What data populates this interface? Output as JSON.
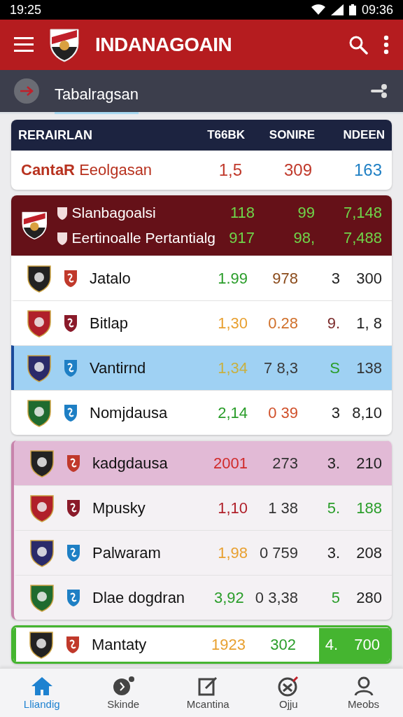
{
  "status_bar": {
    "time": "19:25",
    "clock": "09:36"
  },
  "app_bar": {
    "title": "INDANAGOAIN"
  },
  "sub_bar": {
    "title": "Tabalragsan"
  },
  "table": {
    "columns": [
      "RERAIRLAN",
      "T66BK",
      "SONIRE",
      "NDEEN"
    ],
    "summary": {
      "label_bold": "CantaR",
      "label": "Eeolgasan",
      "values": [
        {
          "text": "1,5",
          "color": "#c0392b"
        },
        {
          "text": "309",
          "color": "#c0392b"
        },
        {
          "text": "163",
          "color": "#1e7fc4"
        }
      ]
    }
  },
  "groups": [
    {
      "kind": "maroon",
      "featured": [
        {
          "name": "Slanbagoalsi",
          "values": [
            "118",
            "99",
            "7,148"
          ]
        },
        {
          "name": "Eertinoalle Pertantialg",
          "values": [
            "917",
            "98,",
            "7,488"
          ]
        }
      ],
      "rows": [
        {
          "name": "Jatalo",
          "selected": false,
          "values": [
            {
              "text": "1.99",
              "color": "#2a9d2a"
            },
            {
              "text": "978",
              "color": "#8a4a1a"
            },
            {
              "text": "3",
              "color": "#222222"
            },
            {
              "text": "300",
              "color": "#222222"
            }
          ]
        },
        {
          "name": "Bitlap",
          "selected": false,
          "values": [
            {
              "text": "1,30",
              "color": "#e8a030"
            },
            {
              "text": "0.28",
              "color": "#d0702a"
            },
            {
              "text": "9.",
              "color": "#7a2a2a"
            },
            {
              "text": "1, 8",
              "color": "#222222"
            }
          ]
        },
        {
          "name": "Vantirnd",
          "selected": true,
          "values": [
            {
              "text": "1,34",
              "color": "#c8b040"
            },
            {
              "text": "7 8,3",
              "color": "#3a3a3a"
            },
            {
              "text": "S",
              "color": "#2a9d2a"
            },
            {
              "text": "138",
              "color": "#333333"
            }
          ]
        },
        {
          "name": "Nomjdausa",
          "selected": false,
          "values": [
            {
              "text": "2,14",
              "color": "#2a9d2a"
            },
            {
              "text": "0 39",
              "color": "#d0502a"
            },
            {
              "text": "3",
              "color": "#222222"
            },
            {
              "text": "8,10",
              "color": "#222222"
            }
          ]
        }
      ]
    },
    {
      "kind": "pink",
      "rows": [
        {
          "name": "kadgdausa",
          "selected": true,
          "values": [
            {
              "text": "2001",
              "color": "#d02a2a"
            },
            {
              "text": "273",
              "color": "#333333"
            },
            {
              "text": "3.",
              "color": "#222222"
            },
            {
              "text": "210",
              "color": "#222222"
            }
          ]
        },
        {
          "name": "Mpusky",
          "selected": false,
          "values": [
            {
              "text": "1,10",
              "color": "#b0202a"
            },
            {
              "text": "1 38",
              "color": "#333333"
            },
            {
              "text": "5.",
              "color": "#2a9d2a"
            },
            {
              "text": "188",
              "color": "#2a9d2a"
            }
          ]
        },
        {
          "name": "Palwaram",
          "selected": false,
          "values": [
            {
              "text": "1,98",
              "color": "#e8a030"
            },
            {
              "text": "0 759",
              "color": "#333333"
            },
            {
              "text": "3.",
              "color": "#222222"
            },
            {
              "text": "208",
              "color": "#222222"
            }
          ]
        },
        {
          "name": "Dlae dogdran",
          "selected": false,
          "values": [
            {
              "text": "3,92",
              "color": "#2a9d2a"
            },
            {
              "text": "0 3,38",
              "color": "#333333"
            },
            {
              "text": "5",
              "color": "#2a9d2a"
            },
            {
              "text": "280",
              "color": "#222222"
            }
          ]
        }
      ]
    },
    {
      "kind": "green",
      "rows": [
        {
          "name": "Mantaty",
          "selected": false,
          "values": [
            {
              "text": "1923",
              "color": "#e8a030"
            },
            {
              "text": "302",
              "color": "#2a9d2a"
            },
            {
              "text": "4.",
              "color": "#ffffff"
            },
            {
              "text": "700",
              "color": "#ffffff"
            }
          ]
        }
      ]
    }
  ],
  "nav": [
    {
      "label": "Lliandig",
      "selected": true
    },
    {
      "label": "Skinde",
      "selected": false
    },
    {
      "label": "Mcantina",
      "selected": false
    },
    {
      "label": "Ojju",
      "selected": false
    },
    {
      "label": "Meobs",
      "selected": false
    }
  ]
}
